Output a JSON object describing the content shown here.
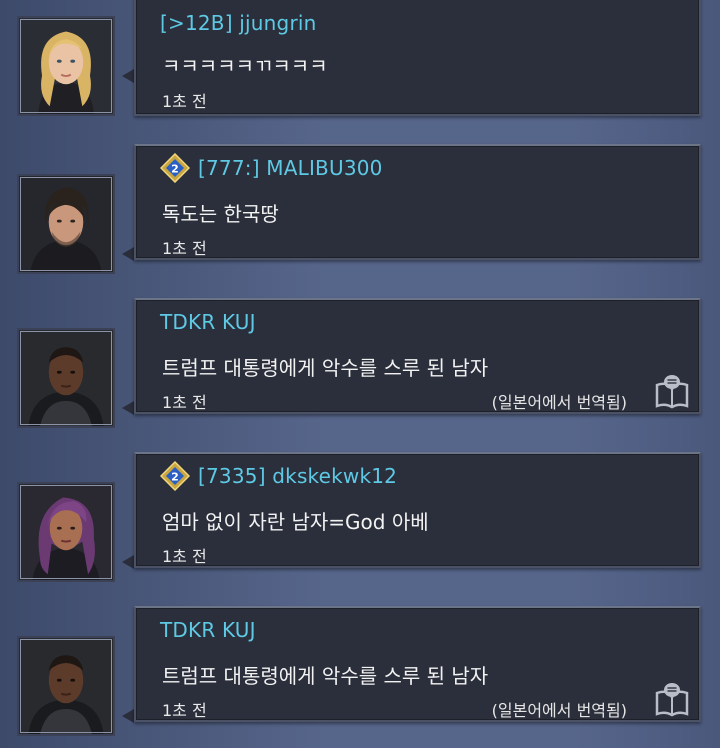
{
  "messages": [
    {
      "name": "[>12B] jjungrin",
      "text": "ㅋㅋㅋㅋㅋㄲㅋㅋㅋ",
      "time": "1초 전",
      "badge": false,
      "translated": null,
      "avatar_icon": "blonde-female-portrait"
    },
    {
      "name": "[777:] MALIBU300",
      "text": "독도는 한국땅",
      "time": "1초 전",
      "badge": true,
      "badge_number": "2",
      "translated": null,
      "avatar_icon": "dark-haired-male-portrait"
    },
    {
      "name": "TDKR KUJ",
      "text": "트럼프 대통령에게 악수를 스루 된 남자",
      "time": "1초 전",
      "badge": false,
      "translated": "(일본어에서 번역됨)",
      "avatar_icon": "dark-skinned-male-portrait"
    },
    {
      "name": "[7335] dkskekwk12",
      "text": "엄마 없이 자란 남자=God 아베",
      "time": "1초 전",
      "badge": true,
      "badge_number": "2",
      "translated": null,
      "avatar_icon": "purple-haired-female-portrait"
    },
    {
      "name": "TDKR KUJ",
      "text": "트럼프 대통령에게 악수를 스루 된 남자",
      "time": "1초 전",
      "badge": false,
      "translated": "(일본어에서 번역됨)",
      "avatar_icon": "dark-skinned-male-portrait"
    }
  ],
  "colors": {
    "name": "#5ec9e4",
    "bubble": "#2b2f3b",
    "background": "#4f5d80",
    "badge_gold": "#c9a640",
    "badge_blue": "#2a5fc4"
  }
}
